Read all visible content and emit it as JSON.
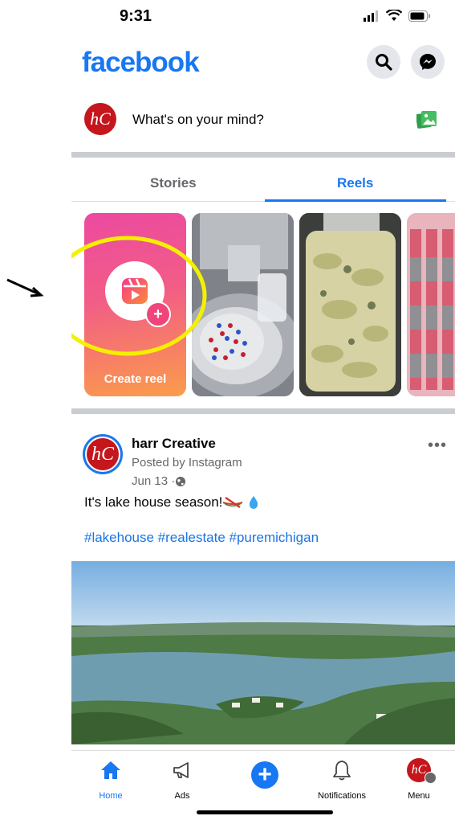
{
  "status_bar": {
    "time": "9:31"
  },
  "header": {
    "logo": "facebook",
    "icons": [
      "search-icon",
      "messenger-icon"
    ]
  },
  "composer": {
    "avatar_text": "hC",
    "prompt": "What's on your mind?",
    "photo_icon": "photo-icon"
  },
  "tabs": [
    {
      "label": "Stories",
      "active": false
    },
    {
      "label": "Reels",
      "active": true
    }
  ],
  "reels": {
    "create_label": "Create reel",
    "create_icon": "reels-icon",
    "plus_icon": "plus-icon"
  },
  "post": {
    "author": "harr Creative",
    "posted_by": "Posted by Instagram",
    "date": "Jun 13 · ",
    "privacy_icon": "globe-icon",
    "text": "It's lake house season! ",
    "hashtags": "#lakehouse #realestate #puremichigan",
    "more_icon": "more-icon"
  },
  "bottom_nav": [
    {
      "label": "Home",
      "icon": "home-icon",
      "active": true
    },
    {
      "label": "Ads",
      "icon": "megaphone-icon",
      "active": false
    },
    {
      "label": "",
      "icon": "create-plus-icon",
      "active": false
    },
    {
      "label": "Notifications",
      "icon": "bell-icon",
      "active": false
    },
    {
      "label": "Menu",
      "icon": "menu-avatar-icon",
      "active": false
    }
  ],
  "colors": {
    "brand_blue": "#1877f2",
    "annotation_yellow": "#f5f000",
    "avatar_red": "#c4161c"
  }
}
